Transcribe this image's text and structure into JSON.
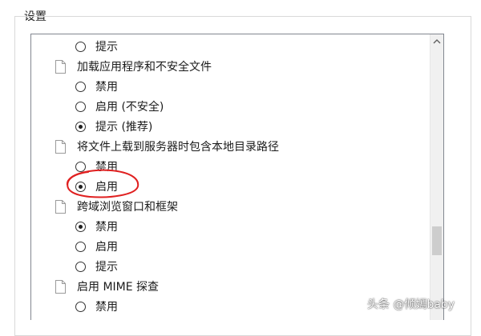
{
  "group": {
    "title": "设置"
  },
  "settings_list": {
    "rows": [
      {
        "kind": "option",
        "label": "提示",
        "checked": false
      },
      {
        "kind": "setting",
        "label": "加载应用程序和不安全文件"
      },
      {
        "kind": "option",
        "label": "禁用",
        "checked": false
      },
      {
        "kind": "option",
        "label": "启用 (不安全)",
        "checked": false
      },
      {
        "kind": "option",
        "label": "提示 (推荐)",
        "checked": true
      },
      {
        "kind": "setting",
        "label": "将文件上载到服务器时包含本地目录路径"
      },
      {
        "kind": "option",
        "label": "禁用",
        "checked": false
      },
      {
        "kind": "option",
        "label": "启用",
        "checked": true
      },
      {
        "kind": "setting",
        "label": "跨域浏览窗口和框架"
      },
      {
        "kind": "option",
        "label": "禁用",
        "checked": true
      },
      {
        "kind": "option",
        "label": "启用",
        "checked": false
      },
      {
        "kind": "option",
        "label": "提示",
        "checked": false
      },
      {
        "kind": "setting",
        "label": "启用 MIME 探查"
      },
      {
        "kind": "option",
        "label": "禁用",
        "checked": false
      }
    ]
  },
  "scrollbar": {
    "up_icon": "chevron-up-icon"
  },
  "annotation": {
    "color": "#e02020",
    "shape": "ellipse"
  },
  "watermark": {
    "text": "头条 @倾嫣baby"
  }
}
